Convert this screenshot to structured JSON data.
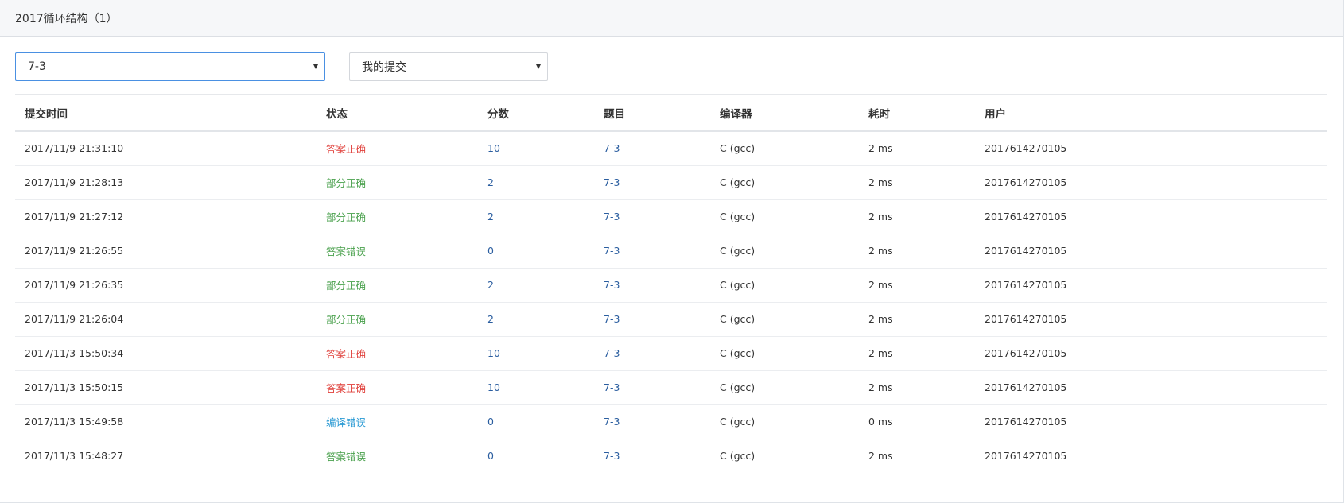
{
  "header": {
    "title": "2017循环结构（1）"
  },
  "filters": {
    "problem_select": {
      "value": "7-3"
    },
    "scope_select": {
      "value": "我的提交"
    }
  },
  "table": {
    "columns": [
      "提交时间",
      "状态",
      "分数",
      "题目",
      "编译器",
      "耗时",
      "用户"
    ],
    "rows": [
      {
        "time": "2017/11/9 21:31:10",
        "status": "答案正确",
        "status_type": "accepted",
        "score": "10",
        "problem": "7-3",
        "compiler": "C (gcc)",
        "duration": "2 ms",
        "user": "2017614270105"
      },
      {
        "time": "2017/11/9 21:28:13",
        "status": "部分正确",
        "status_type": "partial",
        "score": "2",
        "problem": "7-3",
        "compiler": "C (gcc)",
        "duration": "2 ms",
        "user": "2017614270105"
      },
      {
        "time": "2017/11/9 21:27:12",
        "status": "部分正确",
        "status_type": "partial",
        "score": "2",
        "problem": "7-3",
        "compiler": "C (gcc)",
        "duration": "2 ms",
        "user": "2017614270105"
      },
      {
        "time": "2017/11/9 21:26:55",
        "status": "答案错误",
        "status_type": "wrong",
        "score": "0",
        "problem": "7-3",
        "compiler": "C (gcc)",
        "duration": "2 ms",
        "user": "2017614270105"
      },
      {
        "time": "2017/11/9 21:26:35",
        "status": "部分正确",
        "status_type": "partial",
        "score": "2",
        "problem": "7-3",
        "compiler": "C (gcc)",
        "duration": "2 ms",
        "user": "2017614270105"
      },
      {
        "time": "2017/11/9 21:26:04",
        "status": "部分正确",
        "status_type": "partial",
        "score": "2",
        "problem": "7-3",
        "compiler": "C (gcc)",
        "duration": "2 ms",
        "user": "2017614270105"
      },
      {
        "time": "2017/11/3 15:50:34",
        "status": "答案正确",
        "status_type": "accepted",
        "score": "10",
        "problem": "7-3",
        "compiler": "C (gcc)",
        "duration": "2 ms",
        "user": "2017614270105"
      },
      {
        "time": "2017/11/3 15:50:15",
        "status": "答案正确",
        "status_type": "accepted",
        "score": "10",
        "problem": "7-3",
        "compiler": "C (gcc)",
        "duration": "2 ms",
        "user": "2017614270105"
      },
      {
        "time": "2017/11/3 15:49:58",
        "status": "编译错误",
        "status_type": "compile",
        "score": "0",
        "problem": "7-3",
        "compiler": "C (gcc)",
        "duration": "0 ms",
        "user": "2017614270105"
      },
      {
        "time": "2017/11/3 15:48:27",
        "status": "答案错误",
        "status_type": "wrong",
        "score": "0",
        "problem": "7-3",
        "compiler": "C (gcc)",
        "duration": "2 ms",
        "user": "2017614270105"
      }
    ]
  }
}
